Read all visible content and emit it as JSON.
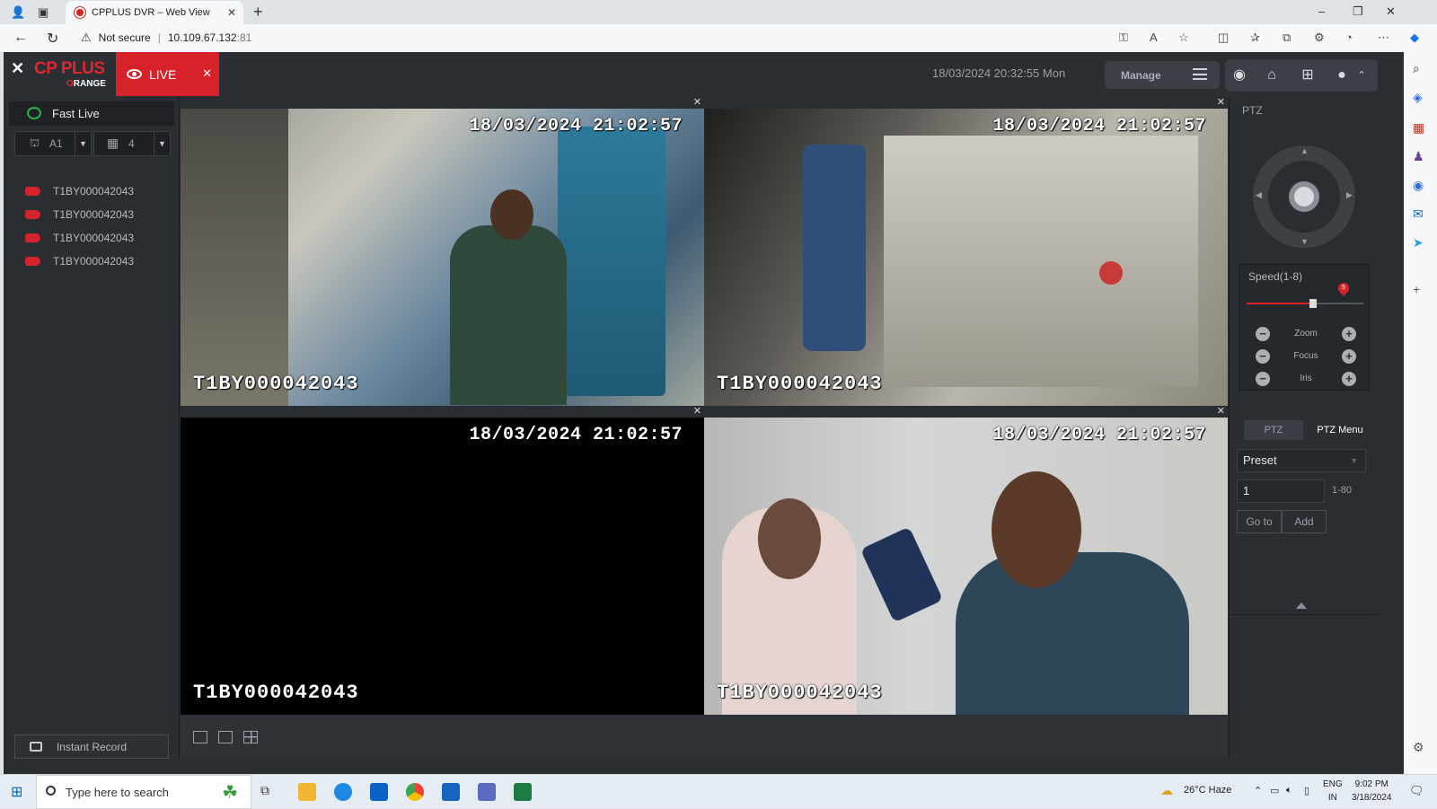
{
  "browser": {
    "tab_title": "CPPLUS DVR – Web View",
    "security_label": "Not secure",
    "url_host": "10.109.67.132",
    "url_port": ":81"
  },
  "app": {
    "logo_main": "CP PLUS",
    "logo_sub_o": "O",
    "logo_sub_rest": "RANGE",
    "live_tab_label": "LIVE",
    "datetime": "18/03/2024 20:32:55 Mon",
    "manage_label": "Manage"
  },
  "left_panel": {
    "fast_live_label": "Fast Live",
    "select_group": "A1",
    "select_layout": "4",
    "devices": [
      "T1BY000042043",
      "T1BY000042043",
      "T1BY000042043",
      "T1BY000042043"
    ],
    "instant_record_label": "Instant Record"
  },
  "channels": [
    {
      "timestamp": "18/03/2024 21:02:57",
      "name": "T1BY000042043",
      "active": true
    },
    {
      "timestamp": "18/03/2024 21:02:57",
      "name": "T1BY000042043",
      "active": false
    },
    {
      "timestamp": "18/03/2024 21:02:57",
      "name": "T1BY000042043",
      "active": false
    },
    {
      "timestamp": "18/03/2024 21:02:57",
      "name": "T1BY000042043",
      "active": false
    }
  ],
  "ptz": {
    "title": "PTZ",
    "speed_label": "Speed(1-8)",
    "speed_value": "5",
    "speed_min": 1,
    "speed_max": 8,
    "zoom_label": "Zoom",
    "focus_label": "Focus",
    "iris_label": "Iris",
    "tab_ptz": "PTZ",
    "tab_menu": "PTZ Menu",
    "preset_label": "Preset",
    "preset_number": "1",
    "preset_range": "1-80",
    "goto_label": "Go to",
    "add_label": "Add"
  },
  "taskbar": {
    "search_placeholder": "Type here to search",
    "weather": "26°C  Haze",
    "lang_top": "ENG",
    "lang_bottom": "IN",
    "time": "9:02 PM",
    "date": "3/18/2024"
  },
  "colors": {
    "accent_red": "#d8222a",
    "active_green": "#26b64d",
    "panel_bg": "#2a2d31"
  }
}
